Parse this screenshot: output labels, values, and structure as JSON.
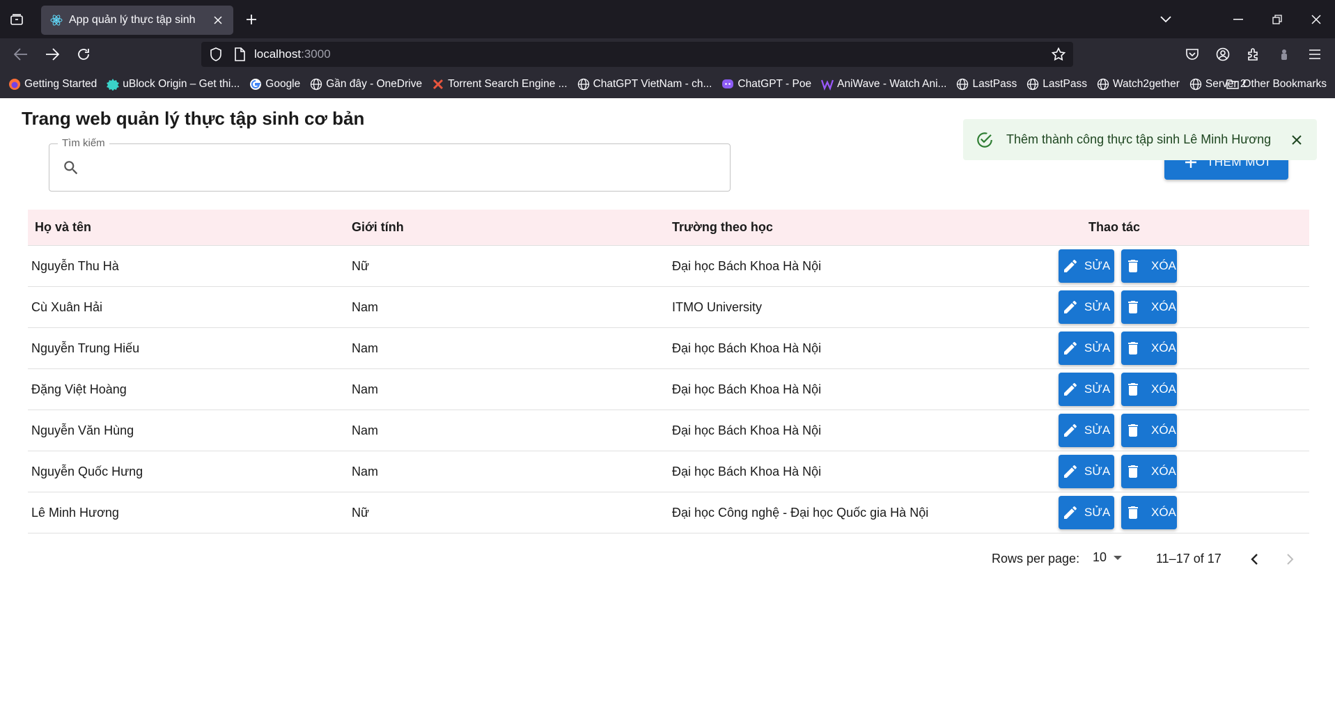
{
  "browser": {
    "tab_title": "App quản lý thực tập sinh",
    "url_host": "localhost",
    "url_port": ":3000",
    "bookmarks": [
      "Getting Started",
      "uBlock Origin – Get thi...",
      "Google",
      "Gần đây - OneDrive",
      "Torrent Search Engine ...",
      "ChatGPT VietNam - ch...",
      "ChatGPT - Poe",
      "AniWave - Watch Ani...",
      "LastPass",
      "LastPass",
      "Watch2gether",
      "Server 2"
    ],
    "other_bookmarks": "Other Bookmarks"
  },
  "page": {
    "title": "Trang web quản lý thực tập sinh cơ bản",
    "search": {
      "legend": "Tìm kiếm",
      "value": ""
    },
    "add_button": "THÊM MỚI",
    "toast": "Thêm thành công thực tập sinh Lê Minh Hương"
  },
  "table": {
    "headers": [
      "Họ và tên",
      "Giới tính",
      "Trường theo học",
      "Thao tác"
    ],
    "edit_label": "SỬA",
    "delete_label": "XÓA",
    "rows": [
      {
        "name": "Nguyễn Thu Hà",
        "gender": "Nữ",
        "school": "Đại học Bách Khoa Hà Nội"
      },
      {
        "name": "Cù Xuân Hải",
        "gender": "Nam",
        "school": "ITMO University"
      },
      {
        "name": "Nguyễn Trung Hiếu",
        "gender": "Nam",
        "school": "Đại học Bách Khoa Hà Nội"
      },
      {
        "name": "Đặng Việt Hoàng",
        "gender": "Nam",
        "school": "Đại học Bách Khoa Hà Nội"
      },
      {
        "name": "Nguyễn Văn Hùng",
        "gender": "Nam",
        "school": "Đại học Bách Khoa Hà Nội"
      },
      {
        "name": "Nguyễn Quốc Hưng",
        "gender": "Nam",
        "school": "Đại học Bách Khoa Hà Nội"
      },
      {
        "name": "Lê Minh Hương",
        "gender": "Nữ",
        "school": "Đại học Công nghệ - Đại học Quốc gia Hà Nội"
      }
    ]
  },
  "pagination": {
    "rows_per_page_label": "Rows per page:",
    "rows_per_page": "10",
    "range": "11–17 of 17"
  },
  "colors": {
    "primary": "#1976d2",
    "header_bg": "#fdecef",
    "toast_bg": "#edf7ed",
    "toast_icon": "#2e7d32"
  }
}
